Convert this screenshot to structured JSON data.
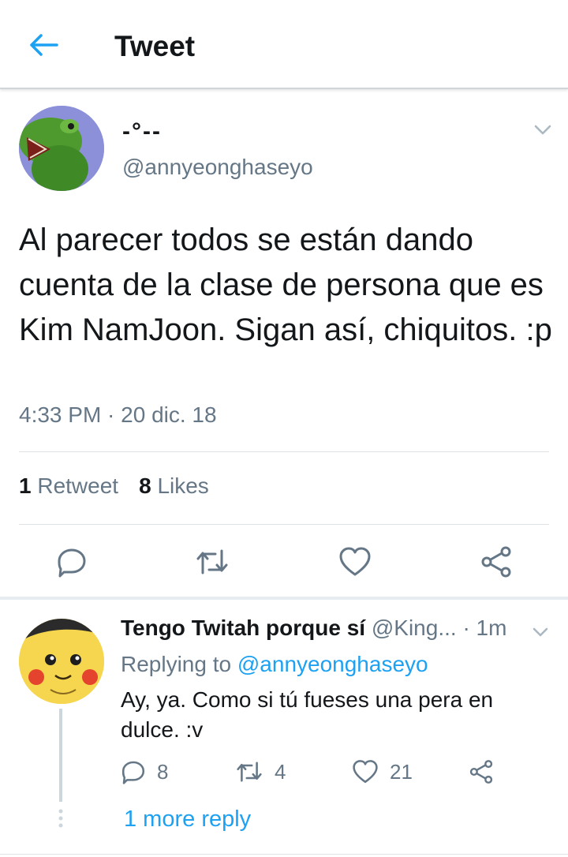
{
  "header": {
    "title": "Tweet",
    "back_icon": "arrow-left-icon"
  },
  "colors": {
    "accent": "#1da1f2",
    "secondary_text": "#657786",
    "primary_text": "#14171a"
  },
  "tweet": {
    "display_name": "-°--",
    "handle": "@annyeonghaseyo",
    "text": "Al parecer todos se están dando cuenta de la clase de persona que es Kim NamJoon. Sigan así, chiquitos. :p",
    "timestamp": "4:33 PM · 20 dic. 18",
    "retweets_count": "1",
    "retweets_label": "Retweet",
    "likes_count": "8",
    "likes_label": "Likes",
    "actions": [
      "reply-icon",
      "retweet-icon",
      "heart-icon",
      "share-icon"
    ]
  },
  "reply": {
    "display_name": "Tengo Twitah porque sí",
    "meta": "@King... · 1m",
    "replying_prefix": "Replying to",
    "replying_to": "@annyeonghaseyo",
    "text": "Ay, ya. Como si tú fueses una pera en dulce. :v",
    "reply_count": "8",
    "retweet_count": "4",
    "like_count": "21"
  },
  "more_replies": "1 more reply"
}
